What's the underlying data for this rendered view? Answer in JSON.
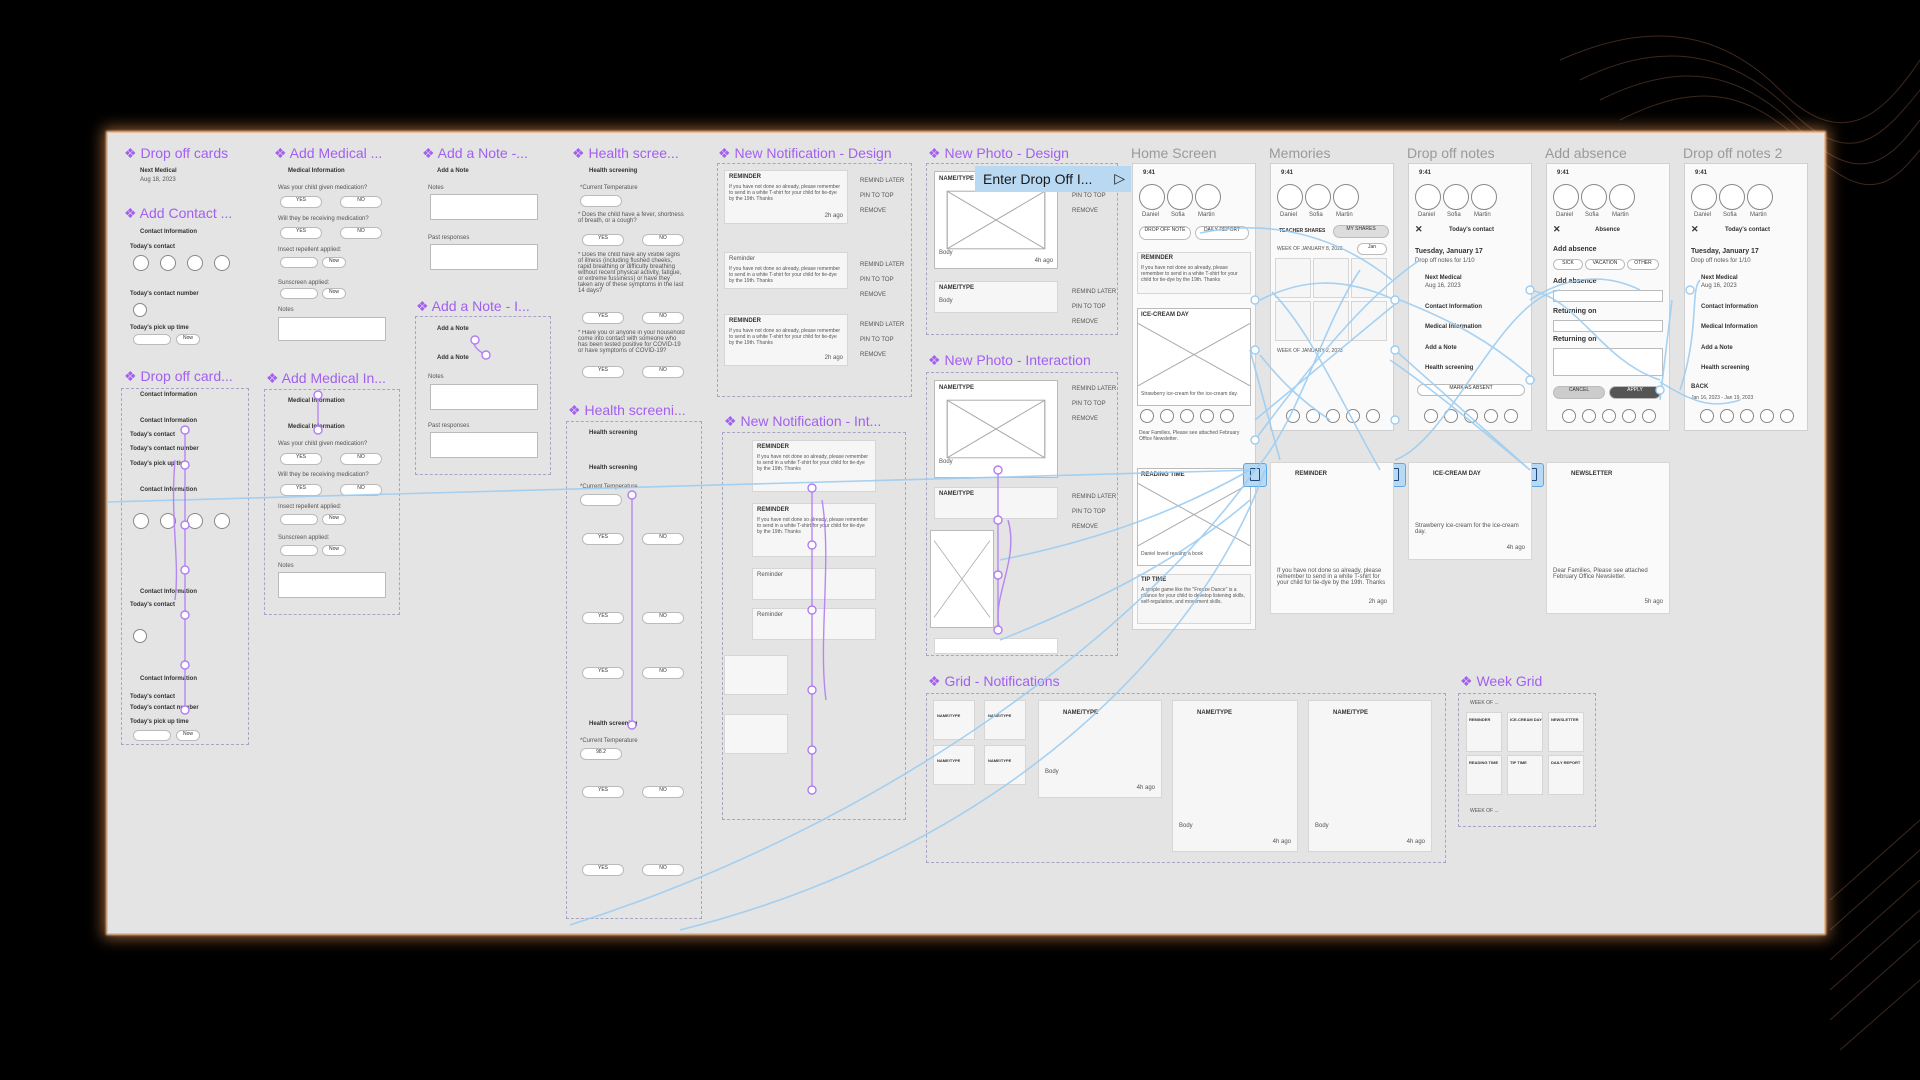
{
  "frames": {
    "drop_off_cards": "Drop off cards",
    "add_contact": "Add Contact ...",
    "drop_off_card_2": "Drop off card...",
    "add_medical_1": "Add Medical ...",
    "add_medical_2": "Add Medical In...",
    "add_note_1": "Add a Note -...",
    "add_note_2": "Add a Note - I...",
    "health_screening_1": "Health scree...",
    "health_screening_2": "Health screeni...",
    "new_notification_design": "New Notification - Design",
    "new_notification_interaction": "New Notification - Int...",
    "new_photo_design": "New Photo - Design",
    "new_photo_interaction": "New Photo - Interaction",
    "grid_notifications": "Grid - Notifications",
    "week_grid": "Week Grid",
    "home_screen": "Home Screen",
    "memories": "Memories",
    "drop_off_notes": "Drop off notes",
    "add_absence": "Add absence",
    "drop_off_notes_2": "Drop off notes 2"
  },
  "tooltip": {
    "label": "Enter Drop Off I...",
    "icon": "play-icon"
  },
  "drop_off_cards": {
    "item": "Next Medical",
    "date": "Aug 18, 2023"
  },
  "contact": {
    "header": "Contact Information",
    "todays_contact": "Today's contact",
    "contact_number": "Today's contact number",
    "pick_up_time": "Today's pick up time",
    "now": "Now",
    "names": [
      "Daniel",
      "Valeria",
      "Martin",
      "Rosie"
    ]
  },
  "medical": {
    "header": "Medical Information",
    "q1": "Was your child given medication?",
    "q2": "Will they be receiving medication?",
    "insect": "Insect repellent applied:",
    "sunscreen": "Sunscreen applied:",
    "notes": "Notes",
    "yes": "YES",
    "no": "NO",
    "now": "Now"
  },
  "note": {
    "header": "Add a Note",
    "notes": "Notes",
    "past": "Past responses",
    "placeholder": "Enter notes here...",
    "none": "No past responses"
  },
  "health": {
    "header": "Health screening",
    "temp": "*Current Temperature",
    "temp_value": "98.2",
    "q1": "* Does the child have a fever, shortness of breath, or a cough?",
    "q2": "* Does the child have any visible signs of illness (including flushed cheeks, rapid breathing or difficulty breathing without recent physical activity, fatigue, or extreme fussiness) or have they taken any of these symptoms in the last 14 days?",
    "q3": "* Have you or anyone in your household come into contact with someone who has been tested positive for COVID-19 or have symptoms of COVID-19?",
    "yes": "YES",
    "no": "NO"
  },
  "notification": {
    "reminder": "REMINDER",
    "reminder2": "Reminder",
    "body": "If you have not done so already, please remember to send in a white T-shirt for your child for tie-dye by the 19th. Thanks",
    "time": "2h ago",
    "actions": [
      "REMIND LATER",
      "PIN TO TOP",
      "REMOVE"
    ]
  },
  "photo": {
    "name_type": "NAME/TYPE",
    "body": "Body",
    "time": "4h ago",
    "actions": [
      "REMIND LATER",
      "PIN TO TOP",
      "REMOVE"
    ]
  },
  "home": {
    "status_time": "9:41",
    "children": [
      "Daniel",
      "Sofia",
      "Martin"
    ],
    "drop_off_note": "DROP OFF NOTE",
    "drop_off_sub": "January 17, 2023",
    "daily_report": "DAILY REPORT",
    "reminder_body": "If you have not done so already, please remember to send in a white T-shirt for your child for tie-dye by the 19th. Thanks",
    "ice_cream": "ICE-CREAM DAY",
    "ice_body": "Strawberry ice-cream for the ice-cream day.",
    "newsletter_body": "Dear Families, Please see attached February Office Newsletter.",
    "reading": "READING TIME",
    "reading_body": "Daniel loved reading a book",
    "tip": "TIP TIME",
    "tip_body": "A simple game like the \"Freeze Dance\" is a chance for your child to develop listening skills, self-regulation, and movement skills."
  },
  "memories": {
    "teacher_shares": "TEACHER SHARES",
    "my_shares": "MY SHARES",
    "week": "WEEK OF JANUARY 8, 2023",
    "week2": "WEEK OF JANUARY 2, 2023",
    "month": "Jan"
  },
  "drop_off_screen": {
    "title": "Today's contact",
    "date": "Tuesday, January 17",
    "sub": "Drop off notes for 1/10",
    "next_medical": "Next Medical",
    "next_date": "Aug 16, 2023",
    "items": [
      "Contact Information",
      "Medical Information",
      "Add a Note",
      "Health screening"
    ],
    "mark_absent": "MARK AS ABSENT"
  },
  "absence": {
    "title": "Absence",
    "add_absence": "Add absence",
    "tabs": [
      "SICK",
      "VACATION",
      "OTHER"
    ],
    "returning": "Returning on",
    "cancel": "CANCEL",
    "apply": "APPLY"
  },
  "drop_off_2": {
    "back": "BACK",
    "range": "Jan 16, 2023 - Jan 19, 2023"
  },
  "expanded": {
    "reminder": "REMINDER",
    "ice_cream": "ICE-CREAM DAY",
    "newsletter": "NEWSLETTER",
    "reminder_body": "If you have not done so already, please remember to send in a white T-shirt for your child for tie-dye by the 19th. Thanks",
    "ice_body": "Strawberry ice-cream for the ice-cream day.",
    "newsletter_body": "Dear Families, Please see attached February Office Newsletter.",
    "t1": "2h ago",
    "t2": "4h ago",
    "t3": "5h ago"
  },
  "grid": {
    "name_type": "NAME/TYPE",
    "body": "Body",
    "time": "4h ago"
  },
  "week_grid": {
    "header": "WEEK OF ...",
    "labels": [
      "REMINDER",
      "ICE-CREAM DAY",
      "NEWSLETTER",
      "READING TIME",
      "TIP TIME",
      "DAILY REPORT"
    ]
  },
  "colors": {
    "accent": "#a25ff0",
    "flow": "#9dcdf2",
    "board": "#e4e4e4",
    "glow": "#ffa05a"
  }
}
